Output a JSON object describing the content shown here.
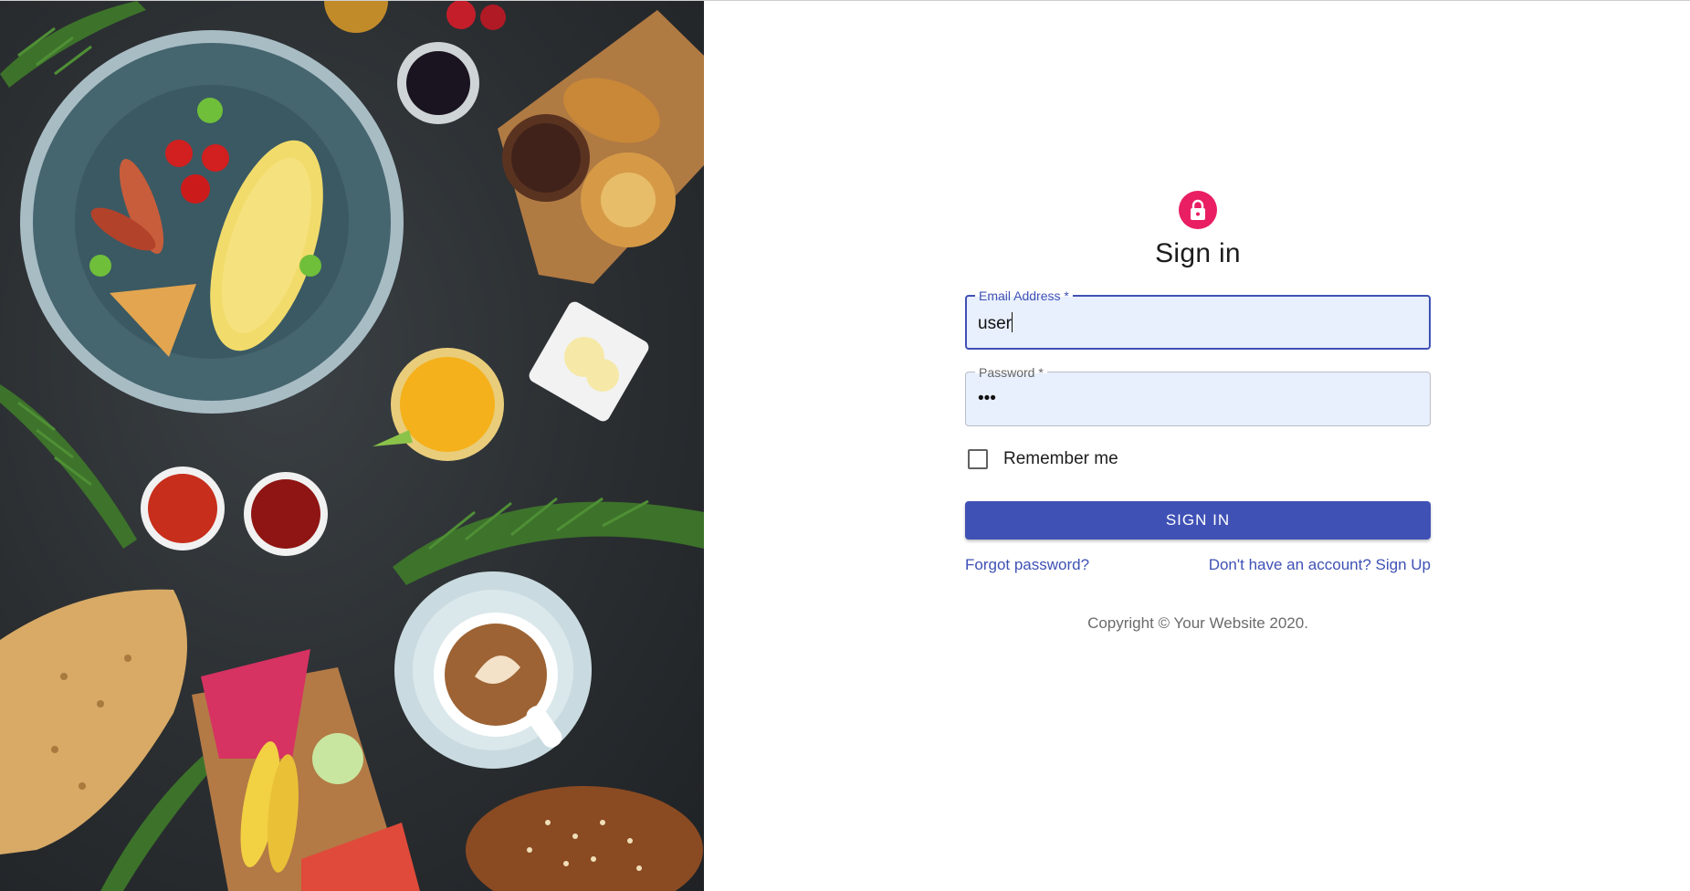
{
  "hero_image": {
    "icon": "breakfast-flatlay-photo"
  },
  "form": {
    "icon": "lock-icon",
    "accent_color": "#e91e63",
    "primary_color": "#3f51b5",
    "title": "Sign in",
    "email": {
      "label": "Email Address *",
      "value": "user"
    },
    "password": {
      "label": "Password *",
      "value": "•••"
    },
    "remember_label": "Remember me",
    "remember_checked": false,
    "submit_label": "SIGN IN",
    "forgot_link": "Forgot password?",
    "signup_link": "Don't have an account? Sign Up",
    "copyright": "Copyright © Your Website 2020."
  }
}
